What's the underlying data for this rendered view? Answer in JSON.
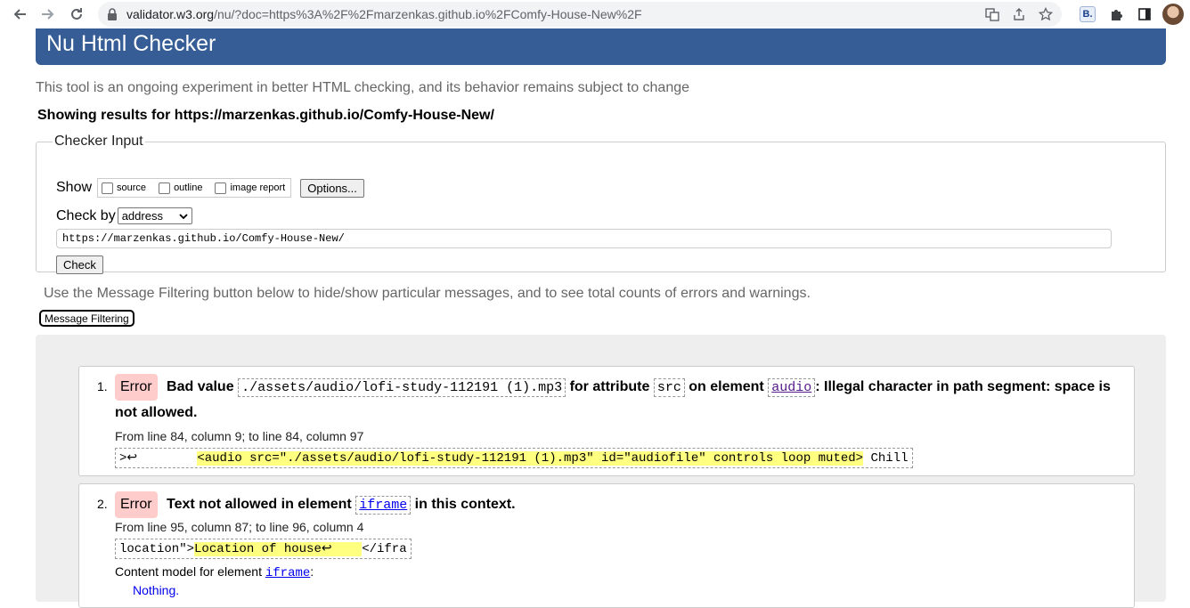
{
  "browser": {
    "url_host": "validator.w3.org",
    "url_rest": "/nu/?doc=https%3A%2F%2Fmarzenkas.github.io%2FComfy-House-New%2F",
    "extension_badge": "B."
  },
  "page": {
    "title": "Nu Html Checker",
    "intro": "This tool is an ongoing experiment in better HTML checking, and its behavior remains subject to change",
    "showing_results": "Showing results for https://marzenkas.github.io/Comfy-House-New/"
  },
  "checker_input": {
    "legend": "Checker Input",
    "show_label": "Show",
    "show_options": [
      "source",
      "outline",
      "image report"
    ],
    "options_button": "Options...",
    "check_by_label": "Check by",
    "check_by_value": "address",
    "url_value": "https://marzenkas.github.io/Comfy-House-New/",
    "check_button": "Check"
  },
  "filtering": {
    "note": "Use the Message Filtering button below to hide/show particular messages, and to see total counts of errors and warnings.",
    "button": "Message Filtering"
  },
  "messages": [
    {
      "number": "1.",
      "type": "Error",
      "parts": [
        "Bad value",
        "./assets/audio/lofi-study-112191 (1).mp3",
        "for attribute",
        "src",
        "on element",
        "audio",
        ": Illegal character in path segment: space is not",
        "allowed."
      ],
      "location": "From line 84, column 9; to line 84, column 97",
      "extract_pre": ">↩        ",
      "extract_hl": "<audio src=\"./assets/audio/lofi-study-112191 (1).mp3\" id=\"audiofile\" controls loop muted>",
      "extract_post": " Chill"
    },
    {
      "number": "2.",
      "type": "Error",
      "parts": [
        "Text not allowed in element",
        "iframe",
        "in this context."
      ],
      "location": "From line 95, column 87; to line 96, column 4",
      "extract_pre": "location\">",
      "extract_hl": "Location of house↩    ",
      "extract_post": "</ifra",
      "content_model_label": "Content model for element",
      "content_model_element": "iframe",
      "content_model_value": "Nothing."
    }
  ]
}
